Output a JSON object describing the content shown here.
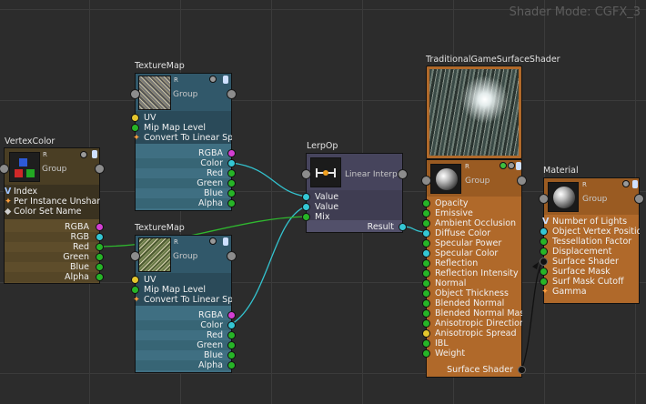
{
  "header": {
    "mode_label": "Shader Mode: CGFX_3"
  },
  "colors": {
    "canvas": "#2c2c2c",
    "node_blue": "#3f6f82",
    "node_purple": "#52506a",
    "node_orange": "#b0692a",
    "node_brown": "#5e4d2b",
    "wire_cyan": "#33c3cf",
    "wire_green": "#2fb82f"
  },
  "nodes": {
    "vertex_color": {
      "title": "VertexColor",
      "channel": "R",
      "group": "Group",
      "params": [
        "Index",
        "Per Instance Unshared",
        "Color Set Name"
      ],
      "outputs": [
        "RGBA",
        "RGB",
        "Red",
        "Green",
        "Blue",
        "Alpha"
      ]
    },
    "texture_map_1": {
      "title": "TextureMap",
      "channel": "R",
      "group": "Group",
      "params": [
        "UV",
        "Mip Map Level",
        "Convert To Linear Space"
      ],
      "outputs": [
        "RGBA",
        "Color",
        "Red",
        "Green",
        "Blue",
        "Alpha"
      ]
    },
    "texture_map_2": {
      "title": "TextureMap",
      "channel": "R",
      "group": "Group",
      "params": [
        "UV",
        "Mip Map Level",
        "Convert To Linear Space"
      ],
      "outputs": [
        "RGBA",
        "Color",
        "Red",
        "Green",
        "Blue",
        "Alpha"
      ]
    },
    "lerp_op": {
      "title": "LerpOp",
      "group": "Linear Interpolation",
      "inputs": [
        "Value",
        "Value",
        "Mix"
      ],
      "output": "Result"
    },
    "traditional": {
      "title": "TraditionalGameSurfaceShader",
      "channel": "R",
      "group": "Group",
      "inputs": [
        "Opacity",
        "Emissive",
        "Ambient Occlusion",
        "Diffuse Color",
        "Specular Power",
        "Specular Color",
        "Reflection",
        "Reflection Intensity",
        "Normal",
        "Object Thickness",
        "Blended Normal",
        "Blended Normal Mask",
        "Anisotropic Direction",
        "Anisotropic Spread",
        "IBL",
        "Weight"
      ],
      "output": "Surface Shader"
    },
    "material": {
      "title": "Material",
      "channel": "R",
      "group": "Group",
      "inputs": [
        "Number of Lights",
        "Object Vertex Position",
        "Tessellation Factor",
        "Displacement",
        "Surface Shader",
        "Surface Mask",
        "Surf Mask Cutoff",
        "Gamma"
      ]
    }
  }
}
